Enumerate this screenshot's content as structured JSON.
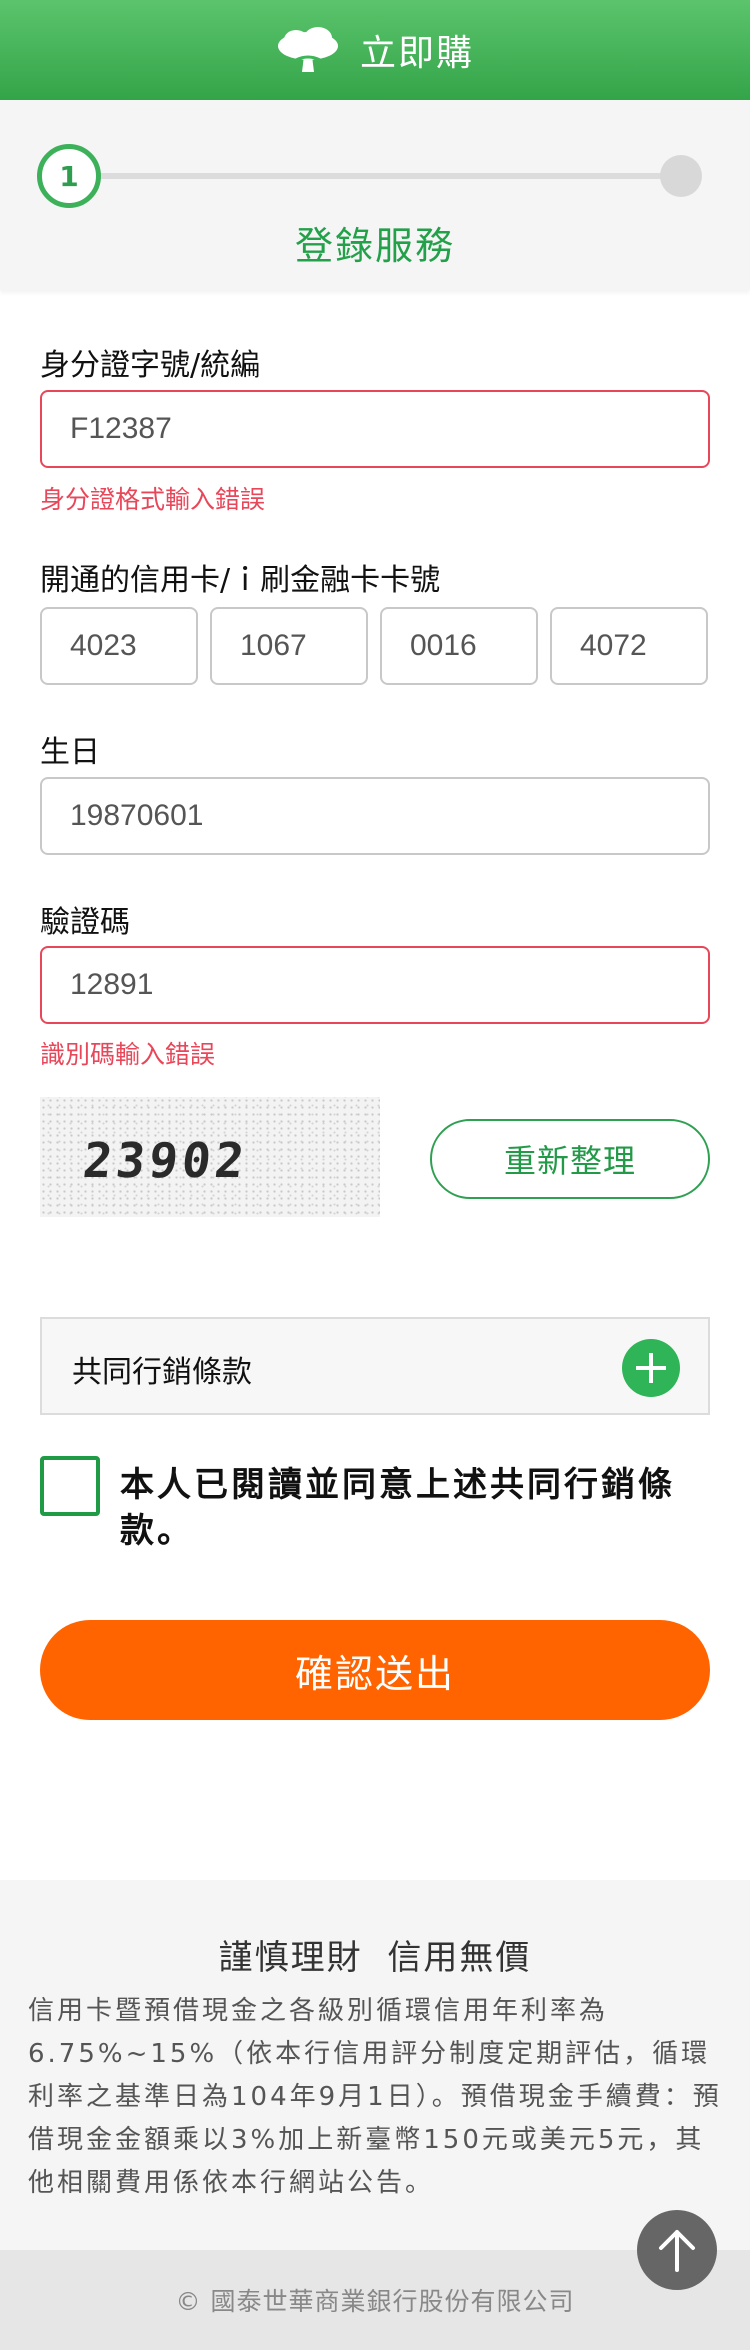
{
  "header": {
    "title": "立即購",
    "logo_icon": "tree-icon",
    "color": "#3fb559"
  },
  "steps": {
    "current": 1,
    "total": 2,
    "step1_number": "1",
    "label": "登錄服務"
  },
  "form": {
    "id": {
      "label": "身分證字號/統編",
      "value": "F12387",
      "error": "身分證格式輸入錯誤"
    },
    "card": {
      "label": "開通的信用卡/ｉ刷金融卡卡號",
      "parts": [
        "4023",
        "1067",
        "0016",
        "4072"
      ]
    },
    "birthday": {
      "label": "生日",
      "value": "19870601"
    },
    "captcha": {
      "label": "驗證碼",
      "value": "12891",
      "error": "識別碼輸入錯誤",
      "image_text": "23902",
      "refresh_label": "重新整理"
    }
  },
  "terms": {
    "label": "共同行銷條款",
    "expand_icon": "plus-icon"
  },
  "agreement": {
    "text": "本人已閱讀並同意上述共同行銷條款。",
    "checked": false
  },
  "submit": {
    "label": "確認送出",
    "color": "#ff6400"
  },
  "footer": {
    "slogan": "謹慎理財  信用無價",
    "notice": "信用卡暨預借現金之各級別循環信用年利率為6.75%~15%（依本行信用評分制度定期評估，循環利率之基準日為104年9月1日）。預借現金手續費：預借現金金額乘以3%加上新臺幣150元或美元5元，其他相關費用係依本行網站公告。",
    "copyright": "© 國泰世華商業銀行股份有限公司"
  },
  "back_to_top_icon": "arrow-up-icon"
}
